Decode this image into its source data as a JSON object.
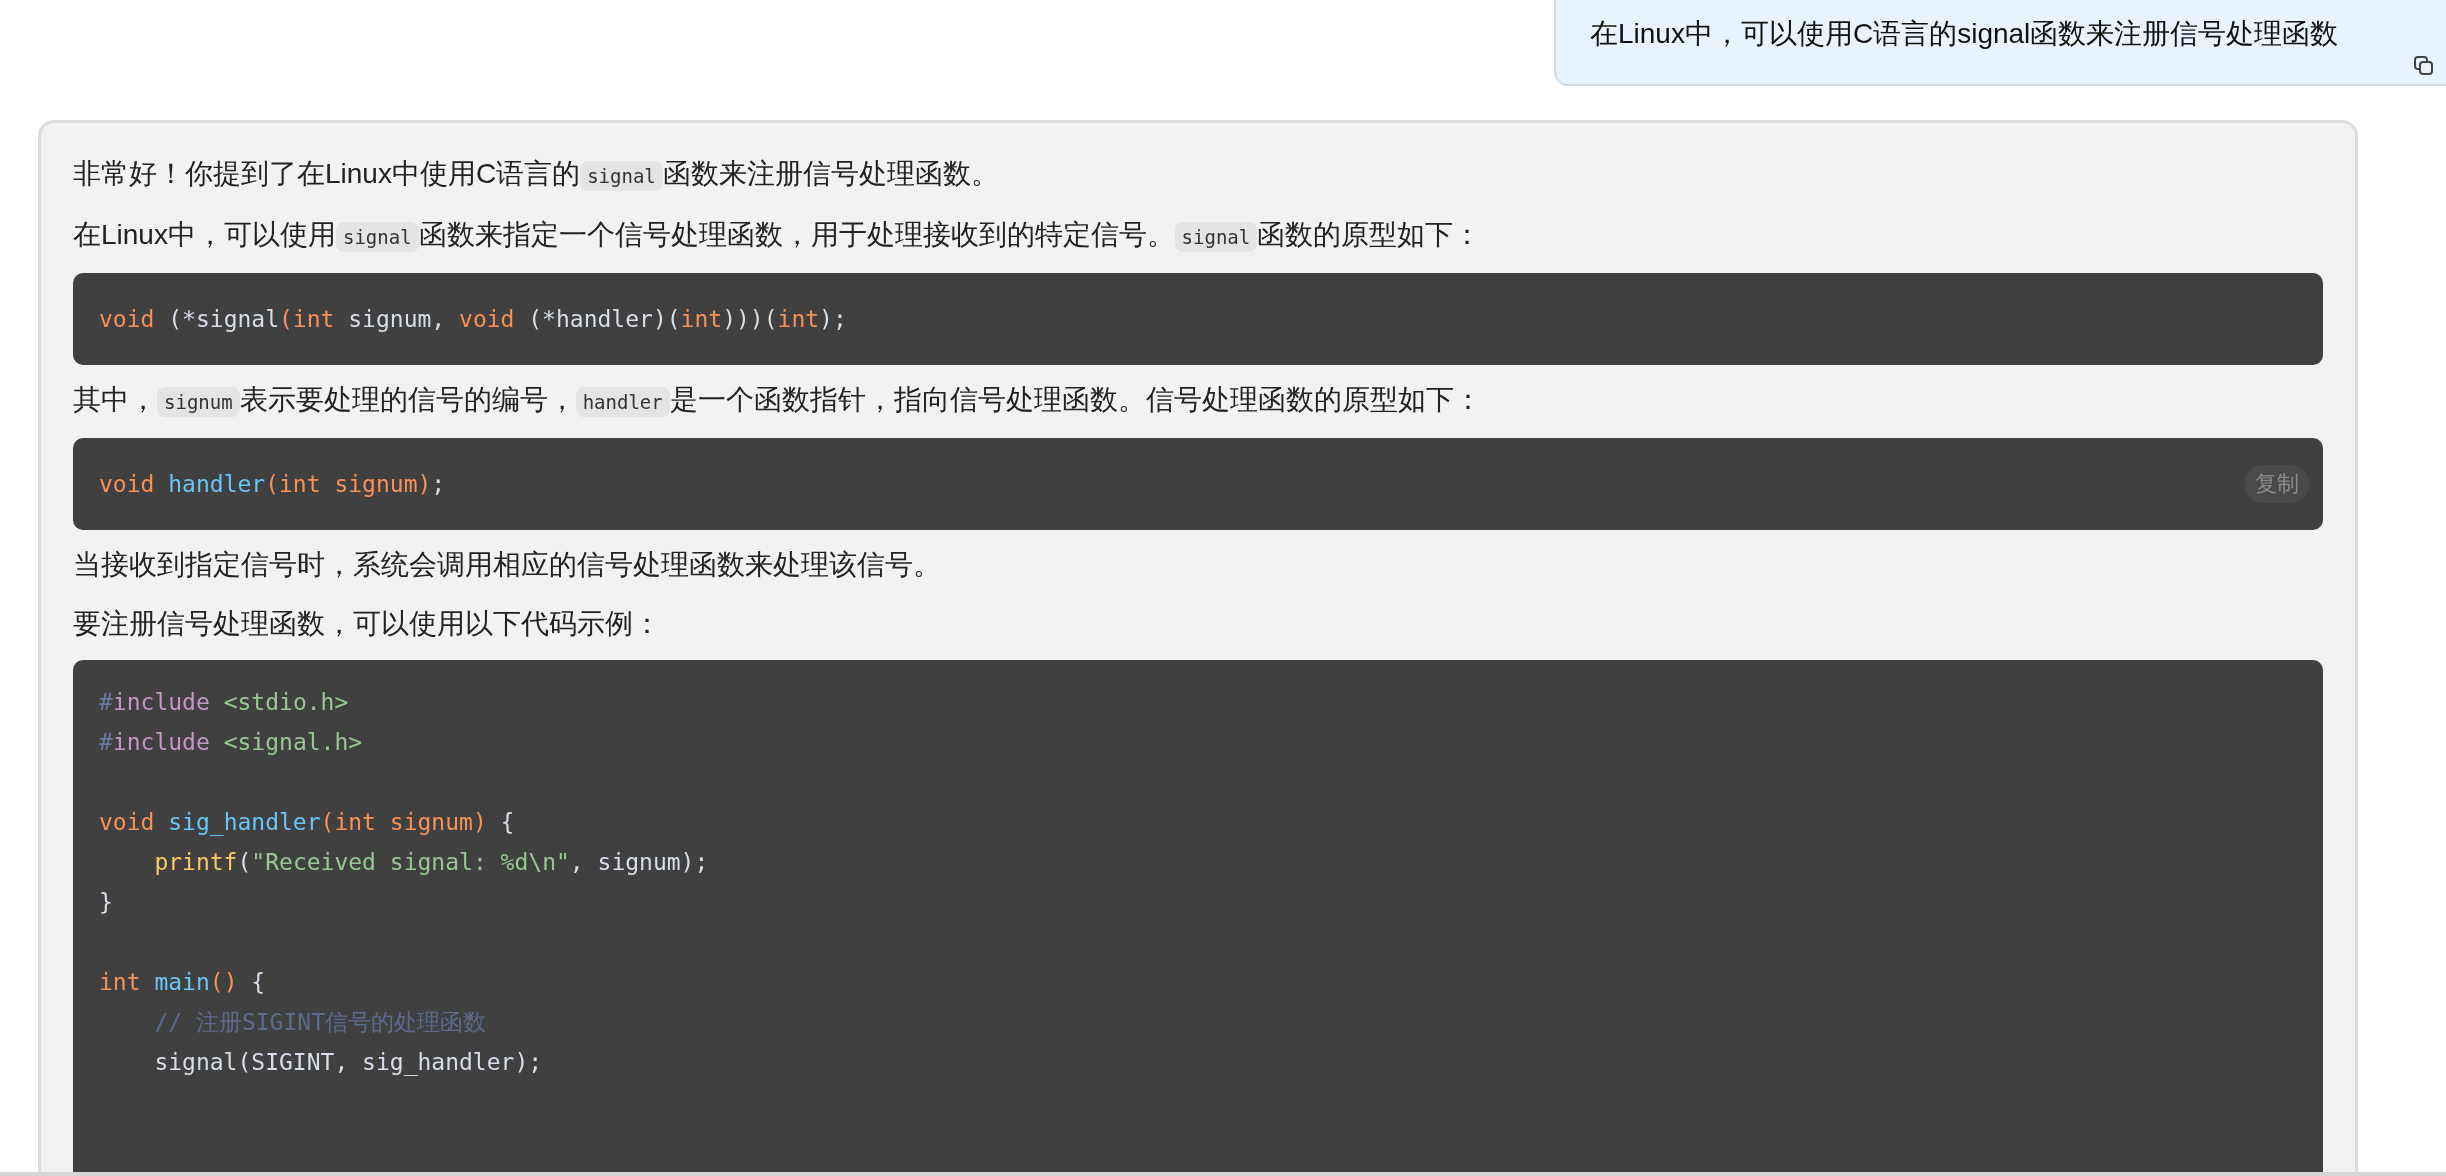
{
  "user_message": {
    "text": "在Linux中，可以使用C语言的signal函数来注册信号处理函数"
  },
  "assistant_message": {
    "content": [
      {
        "kind": "paragraph",
        "segments": [
          {
            "kind": "text",
            "text": "非常好！你提到了在Linux中使用C语言的"
          },
          {
            "kind": "code",
            "text": "signal"
          },
          {
            "kind": "text",
            "text": "函数来注册信号处理函数。"
          }
        ]
      },
      {
        "kind": "paragraph",
        "segments": [
          {
            "kind": "text",
            "text": "在Linux中，可以使用"
          },
          {
            "kind": "code",
            "text": "signal"
          },
          {
            "kind": "text",
            "text": "函数来指定一个信号处理函数，用于处理接收到的特定信号。"
          },
          {
            "kind": "code",
            "text": "signal"
          },
          {
            "kind": "text",
            "text": "函数的原型如下："
          }
        ]
      },
      {
        "kind": "code",
        "groups": [
          [
            [
              {
                "kind": "keyword",
                "text": "void"
              },
              {
                "kind": "plain",
                "text": " (*signal"
              },
              {
                "kind": "keyword",
                "text": "(int"
              },
              {
                "kind": "plain",
                "text": " signum, "
              },
              {
                "kind": "keyword",
                "text": "void"
              },
              {
                "kind": "plain",
                "text": " (*handler)("
              },
              {
                "kind": "keyword",
                "text": "int"
              },
              {
                "kind": "plain",
                "text": ")))("
              },
              {
                "kind": "keyword",
                "text": "int"
              },
              {
                "kind": "plain",
                "text": ");"
              }
            ]
          ]
        ]
      },
      {
        "kind": "paragraph",
        "segments": [
          {
            "kind": "text",
            "text": "其中，"
          },
          {
            "kind": "code",
            "text": "signum"
          },
          {
            "kind": "text",
            "text": "表示要处理的信号的编号，"
          },
          {
            "kind": "code",
            "text": "handler"
          },
          {
            "kind": "text",
            "text": "是一个函数指针，指向信号处理函数。信号处理函数的原型如下："
          }
        ]
      },
      {
        "kind": "code",
        "copy_button": "复制",
        "groups": [
          [
            [
              {
                "kind": "keyword",
                "text": "void"
              },
              {
                "kind": "function",
                "text": " handler"
              },
              {
                "kind": "keyword",
                "text": "(int signum)"
              },
              {
                "kind": "plain",
                "text": ";"
              }
            ]
          ]
        ]
      },
      {
        "kind": "paragraph",
        "segments": [
          {
            "kind": "text",
            "text": "当接收到指定信号时，系统会调用相应的信号处理函数来处理该信号。"
          }
        ]
      },
      {
        "kind": "paragraph",
        "segments": [
          {
            "kind": "text",
            "text": "要注册信号处理函数，可以使用以下代码示例："
          }
        ]
      },
      {
        "kind": "code",
        "groups": [
          [
            [
              {
                "kind": "hash",
                "text": "#"
              },
              {
                "kind": "preproc",
                "text": "include"
              },
              {
                "kind": "string",
                "text": " <stdio.h>"
              }
            ],
            [
              {
                "kind": "hash",
                "text": "#"
              },
              {
                "kind": "preproc",
                "text": "include"
              },
              {
                "kind": "string",
                "text": " <signal.h>"
              }
            ]
          ],
          [
            [
              {
                "kind": "keyword",
                "text": "void"
              },
              {
                "kind": "function",
                "text": " sig_handler"
              },
              {
                "kind": "keyword",
                "text": "(int signum)"
              },
              {
                "kind": "plain",
                "text": " {"
              }
            ],
            [
              {
                "kind": "builtin",
                "text": "    printf"
              },
              {
                "kind": "plain",
                "text": "("
              },
              {
                "kind": "string",
                "text": "\"Received signal: %d\\n\""
              },
              {
                "kind": "plain",
                "text": ", signum);"
              }
            ],
            [
              {
                "kind": "plain",
                "text": "}"
              }
            ]
          ],
          [
            [
              {
                "kind": "keyword",
                "text": "int"
              },
              {
                "kind": "function",
                "text": " main"
              },
              {
                "kind": "keyword",
                "text": "()"
              },
              {
                "kind": "plain",
                "text": " {"
              }
            ],
            [
              {
                "kind": "comment",
                "text": "    // 注册SIGINT信号的处理函数"
              }
            ],
            [
              {
                "kind": "plain",
                "text": "    signal(SIGINT, sig_handler);"
              }
            ]
          ]
        ]
      }
    ]
  }
}
